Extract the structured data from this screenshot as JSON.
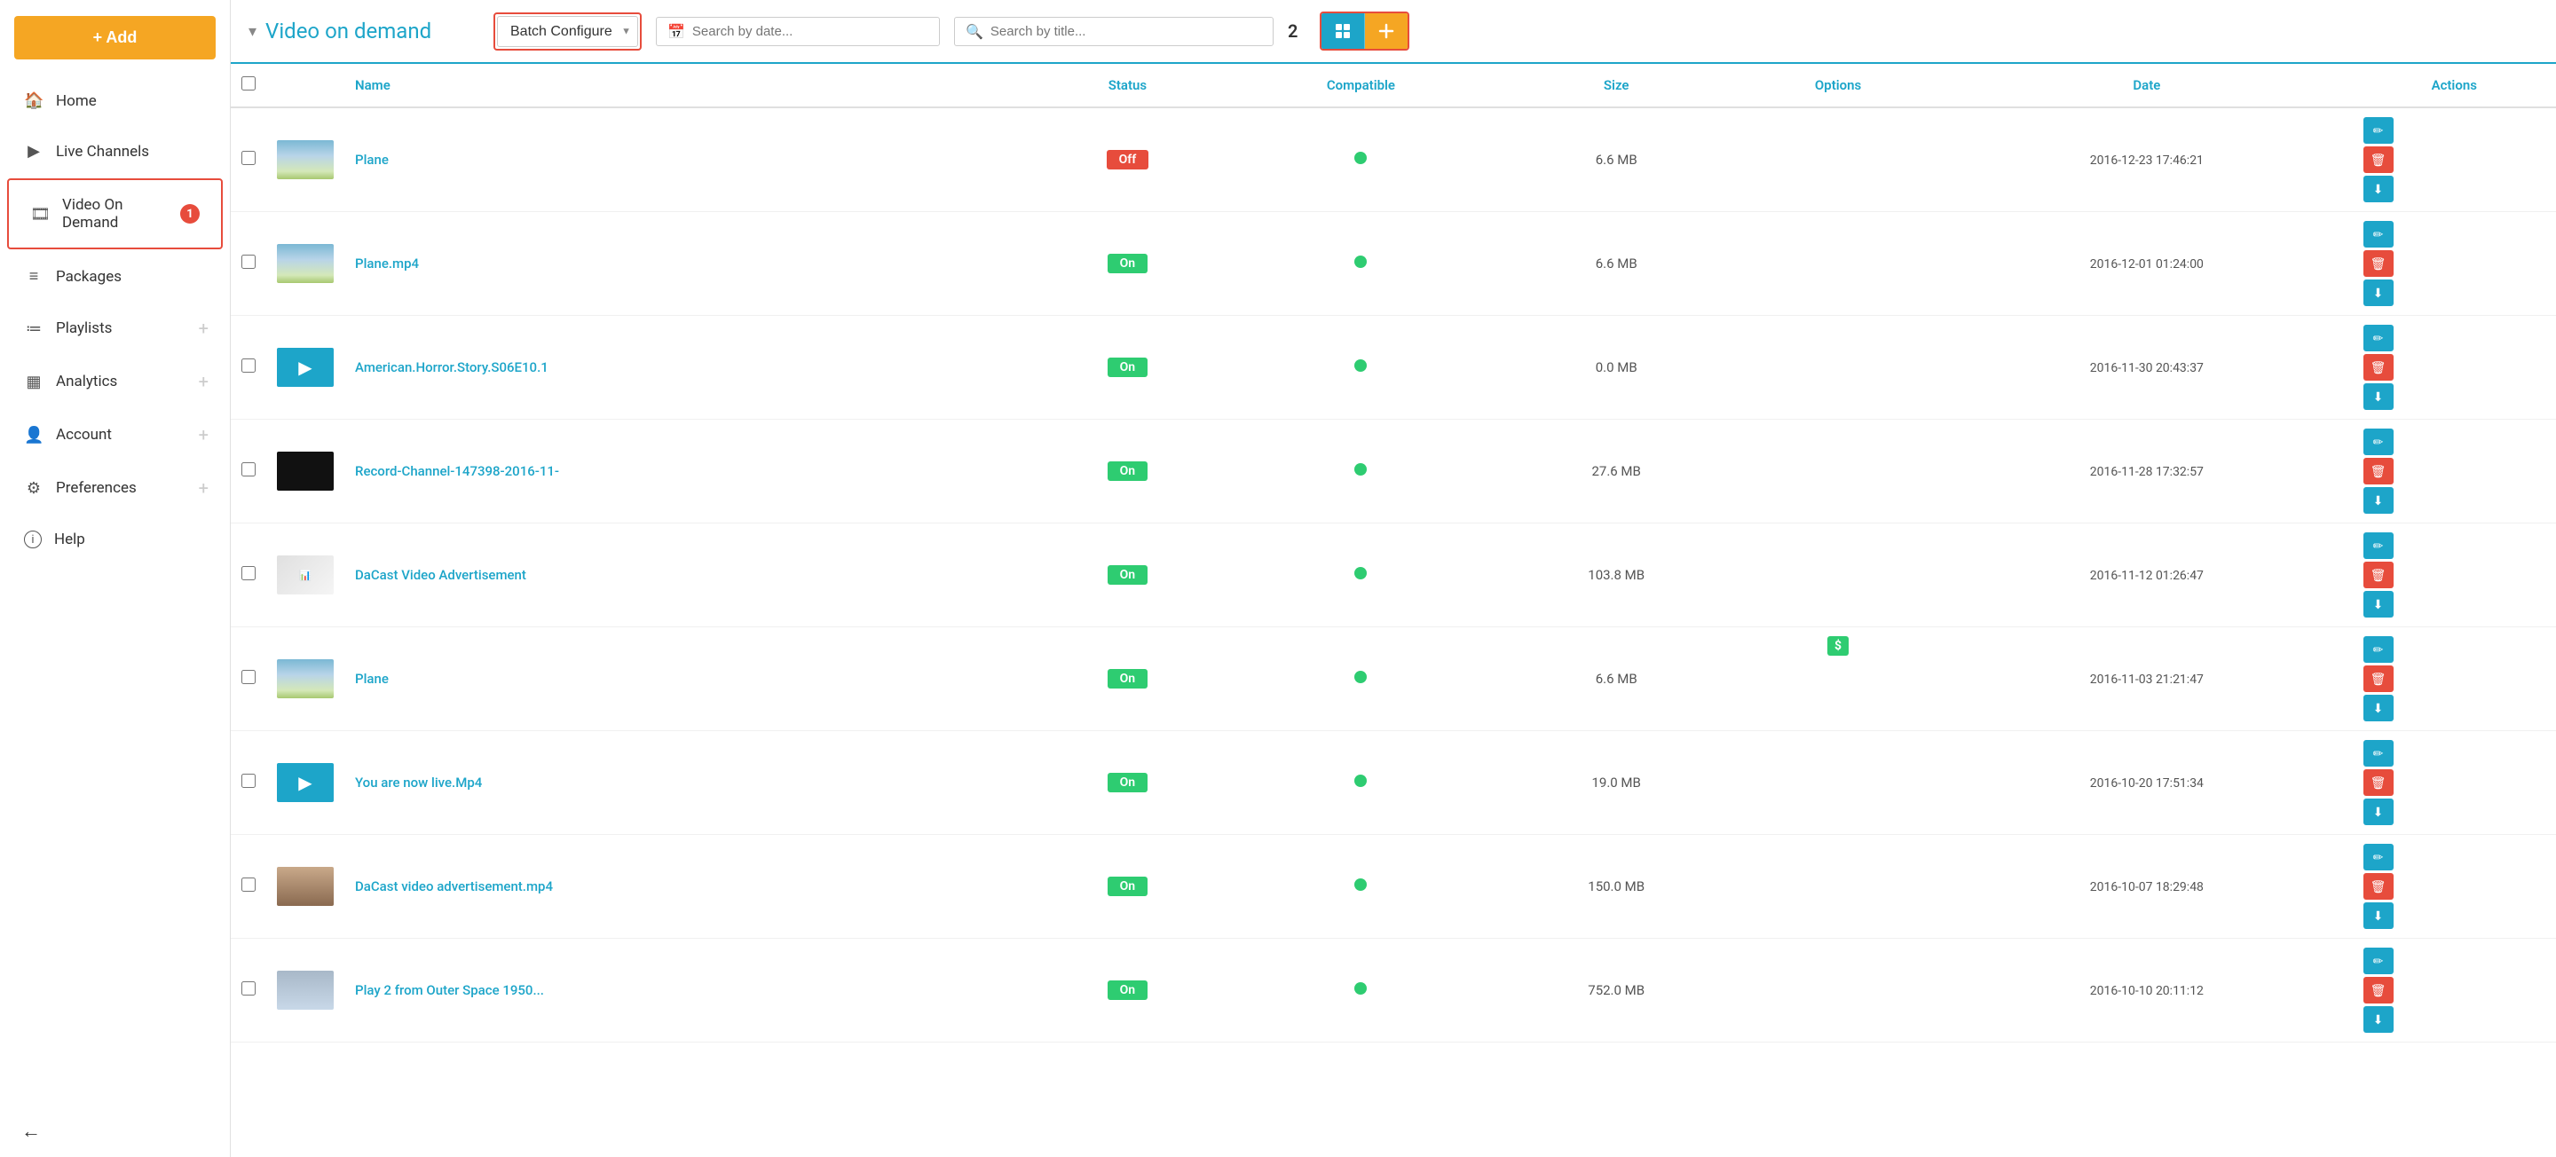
{
  "sidebar": {
    "add_label": "+ Add",
    "nav_items": [
      {
        "id": "home",
        "label": "Home",
        "icon": "🏠",
        "active": false
      },
      {
        "id": "live-channels",
        "label": "Live Channels",
        "icon": "▶",
        "active": false
      },
      {
        "id": "video-on-demand",
        "label": "Video On Demand",
        "icon": "🎞",
        "active": true
      },
      {
        "id": "packages",
        "label": "Packages",
        "icon": "📦",
        "active": false
      },
      {
        "id": "playlists",
        "label": "Playlists",
        "icon": "☰",
        "active": false,
        "has_plus": true
      },
      {
        "id": "analytics",
        "label": "Analytics",
        "icon": "📊",
        "active": false,
        "has_plus": true
      },
      {
        "id": "account",
        "label": "Account",
        "icon": "👤",
        "active": false,
        "has_plus": true
      },
      {
        "id": "preferences",
        "label": "Preferences",
        "icon": "⚙",
        "active": false,
        "has_plus": true
      },
      {
        "id": "help",
        "label": "Help",
        "icon": "ℹ",
        "active": false
      }
    ]
  },
  "header": {
    "dropdown_arrow": "▾",
    "title": "Video on demand",
    "batch_configure_label": "Batch Configure",
    "search_date_placeholder": "Search by date...",
    "search_title_placeholder": "Search by title...",
    "count": "2",
    "grid_icon": "⊞",
    "add_icon": "+"
  },
  "table": {
    "columns": {
      "name": "Name",
      "status": "Status",
      "compatible": "Compatible",
      "size": "Size",
      "options": "Options",
      "date": "Date",
      "actions": "Actions"
    },
    "rows": [
      {
        "id": 1,
        "thumb_type": "sky",
        "name": "Plane",
        "status": "Off",
        "status_on": false,
        "compatible": true,
        "size": "6.6 MB",
        "options": "",
        "date": "2016-12-23 17:46:21"
      },
      {
        "id": 2,
        "thumb_type": "sky",
        "name": "Plane.mp4",
        "status": "On",
        "status_on": true,
        "compatible": true,
        "size": "6.6 MB",
        "options": "",
        "date": "2016-12-01 01:24:00"
      },
      {
        "id": 3,
        "thumb_type": "teal",
        "name": "American.Horror.Story.S06E10.1",
        "status": "On",
        "status_on": true,
        "compatible": true,
        "size": "0.0 MB",
        "options": "",
        "date": "2016-11-30 20:43:37"
      },
      {
        "id": 4,
        "thumb_type": "black",
        "name": "Record-Channel-147398-2016-11-",
        "status": "On",
        "status_on": true,
        "compatible": true,
        "size": "27.6 MB",
        "options": "",
        "date": "2016-11-28 17:32:57"
      },
      {
        "id": 5,
        "thumb_type": "presentation",
        "name": "DaCast Video Advertisement",
        "status": "On",
        "status_on": true,
        "compatible": true,
        "size": "103.8 MB",
        "options": "",
        "date": "2016-11-12 01:26:47"
      },
      {
        "id": 6,
        "thumb_type": "sky",
        "name": "Plane",
        "status": "On",
        "status_on": true,
        "compatible": true,
        "size": "6.6 MB",
        "options": "$",
        "date": "2016-11-03 21:21:47"
      },
      {
        "id": 7,
        "thumb_type": "teal",
        "name": "You are now live.Mp4",
        "status": "On",
        "status_on": true,
        "compatible": true,
        "size": "19.0 MB",
        "options": "",
        "date": "2016-10-20 17:51:34"
      },
      {
        "id": 8,
        "thumb_type": "person",
        "name": "DaCast video advertisement.mp4",
        "status": "On",
        "status_on": true,
        "compatible": true,
        "size": "150.0 MB",
        "options": "",
        "date": "2016-10-07 18:29:48"
      },
      {
        "id": 9,
        "thumb_type": "cloudy",
        "name": "Play 2 from Outer Space 1950...",
        "status": "On",
        "status_on": true,
        "compatible": true,
        "size": "752.0 MB",
        "options": "",
        "date": "2016-10-10 20:11:12"
      }
    ]
  },
  "colors": {
    "teal": "#1da5c9",
    "orange": "#f5a623",
    "red": "#e74c3c",
    "green": "#2ecc71"
  }
}
